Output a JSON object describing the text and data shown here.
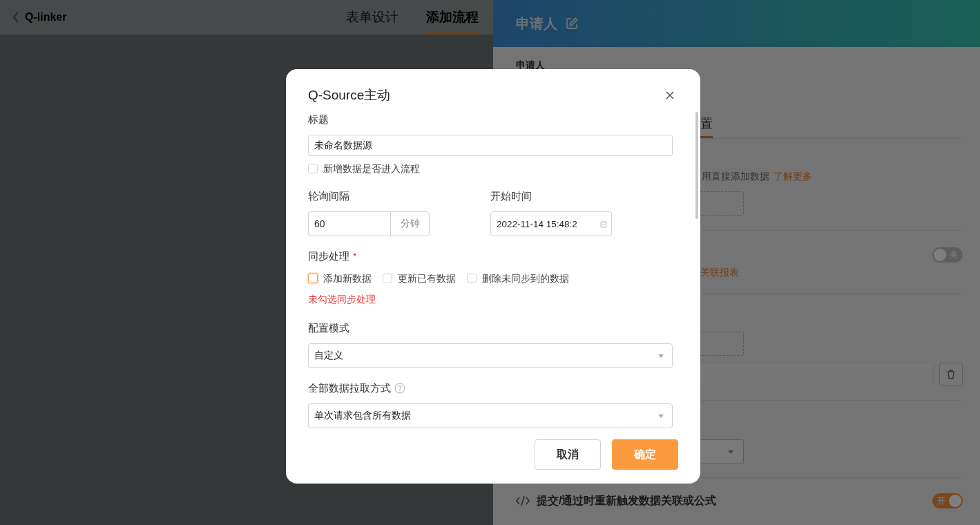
{
  "top_bar": {
    "back_label": "Q-linker",
    "tabs": [
      {
        "label": "表单设计",
        "selected": false
      },
      {
        "label": "添加流程",
        "selected": true
      }
    ]
  },
  "side_panel": {
    "title": "申请人",
    "field_label": "申请人",
    "tab": {
      "label": "置",
      "selected": true
    },
    "hint": "用直接添加数据",
    "hint_link": "了解更多",
    "report_toggle": {
      "label": "关",
      "on": false
    },
    "report_link": "关联报表",
    "retrigger": {
      "title": "提交/通过时重新触发数据关联或公式",
      "toggle": {
        "label": "开",
        "on": true
      }
    }
  },
  "dialog": {
    "title": "Q-Source主动",
    "title_field": {
      "label": "标题",
      "value": "未命名数据源"
    },
    "enter_flow": {
      "label": "新增数据是否进入流程",
      "checked": false
    },
    "poll_interval": {
      "label": "轮询间隔",
      "value": "60",
      "unit": "分钟"
    },
    "start_time": {
      "label": "开始时间",
      "value": "2022-11-14 15:48:2"
    },
    "sync": {
      "label": "同步处理",
      "required_mark": "*",
      "options": [
        {
          "label": "添加新数据",
          "checked": false,
          "focused": true
        },
        {
          "label": "更新已有数据",
          "checked": false,
          "focused": false
        },
        {
          "label": "删除未同步到的数据",
          "checked": false,
          "focused": false
        }
      ],
      "error": "未勾选同步处理"
    },
    "config_mode": {
      "label": "配置模式",
      "value": "自定义"
    },
    "fetch_mode": {
      "label": "全部数据拉取方式",
      "value": "单次请求包含所有数据"
    },
    "buttons": [
      {
        "label": "取消",
        "kind": "secondary"
      },
      {
        "label": "确定",
        "kind": "primary"
      }
    ]
  }
}
